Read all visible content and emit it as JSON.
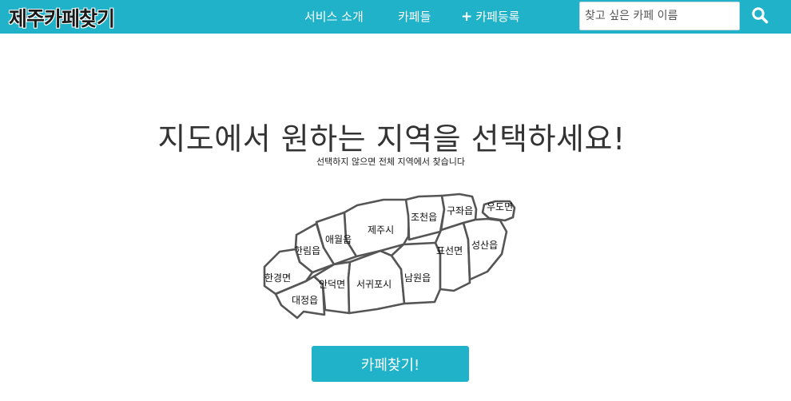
{
  "header": {
    "brand": "제주카페찾기",
    "nav": {
      "about": "서비스 소개",
      "cafes": "카페들",
      "register": "카페등록"
    },
    "search": {
      "placeholder": "찾고 싶은 카페 이름",
      "value": ""
    }
  },
  "main": {
    "title": "지도에서 원하는 지역을 선택하세요!",
    "subtitle": "선택하지 않으면 전체 지역에서 찾습니다",
    "regions": {
      "jeju_si": "제주시",
      "jocheon": "조천읍",
      "gujwa": "구좌읍",
      "udo": "우도면",
      "aewol": "애월읍",
      "hallim": "한림읍",
      "hangyeong": "한경면",
      "daejeong": "대정읍",
      "andeok": "안덕면",
      "seogwipo": "서귀포시",
      "namwon": "남원읍",
      "pyoseon": "표선면",
      "seongsan": "성산읍"
    },
    "find_button": "카페찾기!"
  },
  "colors": {
    "accent": "#1fb2c8",
    "map_stroke": "#555555"
  },
  "icons": {
    "search": "search-icon",
    "plus": "plus-icon"
  }
}
